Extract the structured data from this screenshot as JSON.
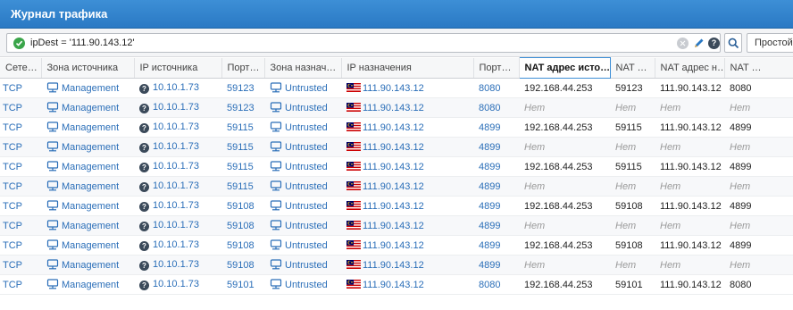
{
  "window": {
    "title": "Журнал трафика"
  },
  "filter": {
    "query": "ipDest = '111.90.143.12'",
    "simple_label": "Простой"
  },
  "columns": [
    "Сете…",
    "Зона источника",
    "IP источника",
    "Порт…",
    "Зона назнач…",
    "IP назначения",
    "Порт…",
    "NAT адрес исто…",
    "NAT …",
    "NAT адрес н…",
    "NAT …"
  ],
  "active_column_index": 7,
  "rows": [
    {
      "proto": "TCP",
      "src_zone": "Management",
      "src_ip": "10.10.1.73",
      "src_port": "59123",
      "dst_zone": "Untrusted",
      "dst_ip": "111.90.143.12",
      "dst_port": "8080",
      "nat_src": "192.168.44.253",
      "nat_src_port": "59123",
      "nat_dst": "111.90.143.12",
      "nat_dst_port": "8080"
    },
    {
      "proto": "TCP",
      "src_zone": "Management",
      "src_ip": "10.10.1.73",
      "src_port": "59123",
      "dst_zone": "Untrusted",
      "dst_ip": "111.90.143.12",
      "dst_port": "8080",
      "nat_src": "Нет",
      "nat_src_port": "Нет",
      "nat_dst": "Нет",
      "nat_dst_port": "Нет"
    },
    {
      "proto": "TCP",
      "src_zone": "Management",
      "src_ip": "10.10.1.73",
      "src_port": "59115",
      "dst_zone": "Untrusted",
      "dst_ip": "111.90.143.12",
      "dst_port": "4899",
      "nat_src": "192.168.44.253",
      "nat_src_port": "59115",
      "nat_dst": "111.90.143.12",
      "nat_dst_port": "4899"
    },
    {
      "proto": "TCP",
      "src_zone": "Management",
      "src_ip": "10.10.1.73",
      "src_port": "59115",
      "dst_zone": "Untrusted",
      "dst_ip": "111.90.143.12",
      "dst_port": "4899",
      "nat_src": "Нет",
      "nat_src_port": "Нет",
      "nat_dst": "Нет",
      "nat_dst_port": "Нет"
    },
    {
      "proto": "TCP",
      "src_zone": "Management",
      "src_ip": "10.10.1.73",
      "src_port": "59115",
      "dst_zone": "Untrusted",
      "dst_ip": "111.90.143.12",
      "dst_port": "4899",
      "nat_src": "192.168.44.253",
      "nat_src_port": "59115",
      "nat_dst": "111.90.143.12",
      "nat_dst_port": "4899"
    },
    {
      "proto": "TCP",
      "src_zone": "Management",
      "src_ip": "10.10.1.73",
      "src_port": "59115",
      "dst_zone": "Untrusted",
      "dst_ip": "111.90.143.12",
      "dst_port": "4899",
      "nat_src": "Нет",
      "nat_src_port": "Нет",
      "nat_dst": "Нет",
      "nat_dst_port": "Нет"
    },
    {
      "proto": "TCP",
      "src_zone": "Management",
      "src_ip": "10.10.1.73",
      "src_port": "59108",
      "dst_zone": "Untrusted",
      "dst_ip": "111.90.143.12",
      "dst_port": "4899",
      "nat_src": "192.168.44.253",
      "nat_src_port": "59108",
      "nat_dst": "111.90.143.12",
      "nat_dst_port": "4899"
    },
    {
      "proto": "TCP",
      "src_zone": "Management",
      "src_ip": "10.10.1.73",
      "src_port": "59108",
      "dst_zone": "Untrusted",
      "dst_ip": "111.90.143.12",
      "dst_port": "4899",
      "nat_src": "Нет",
      "nat_src_port": "Нет",
      "nat_dst": "Нет",
      "nat_dst_port": "Нет"
    },
    {
      "proto": "TCP",
      "src_zone": "Management",
      "src_ip": "10.10.1.73",
      "src_port": "59108",
      "dst_zone": "Untrusted",
      "dst_ip": "111.90.143.12",
      "dst_port": "4899",
      "nat_src": "192.168.44.253",
      "nat_src_port": "59108",
      "nat_dst": "111.90.143.12",
      "nat_dst_port": "4899"
    },
    {
      "proto": "TCP",
      "src_zone": "Management",
      "src_ip": "10.10.1.73",
      "src_port": "59108",
      "dst_zone": "Untrusted",
      "dst_ip": "111.90.143.12",
      "dst_port": "4899",
      "nat_src": "Нет",
      "nat_src_port": "Нет",
      "nat_dst": "Нет",
      "nat_dst_port": "Нет"
    },
    {
      "proto": "TCP",
      "src_zone": "Management",
      "src_ip": "10.10.1.73",
      "src_port": "59101",
      "dst_zone": "Untrusted",
      "dst_ip": "111.90.143.12",
      "dst_port": "8080",
      "nat_src": "192.168.44.253",
      "nat_src_port": "59101",
      "nat_dst": "111.90.143.12",
      "nat_dst_port": "8080"
    }
  ],
  "none_value": "Нет",
  "colors": {
    "header": "#2a79c4",
    "link": "#2a6eb8",
    "accent_green": "#3aa54a"
  },
  "icons": [
    "check-circle-icon",
    "clear-icon",
    "edit-icon",
    "help-icon",
    "search-icon",
    "zone-network-icon",
    "unknown-host-icon",
    "malaysia-flag-icon"
  ]
}
